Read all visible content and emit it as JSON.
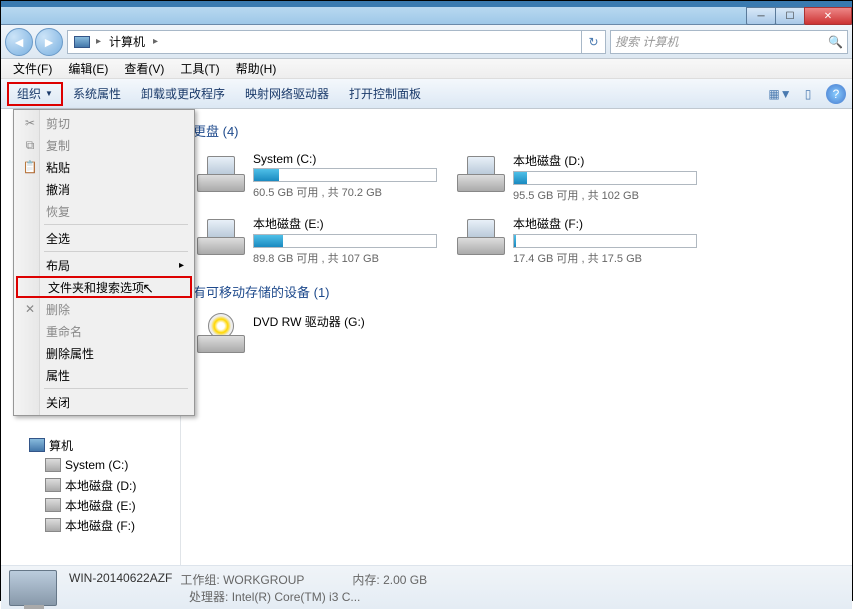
{
  "window": {
    "minimize": "─",
    "maximize": "☐",
    "close": "✕"
  },
  "nav": {
    "back": "◄",
    "fwd": "►",
    "path_root": "计算机",
    "path_arrow": "▸",
    "refresh": "↻",
    "search_placeholder": "搜索 计算机",
    "search_icon": "🔍"
  },
  "menu": {
    "file": "文件(F)",
    "edit": "编辑(E)",
    "view": "查看(V)",
    "tools": "工具(T)",
    "help": "帮助(H)"
  },
  "toolbar": {
    "organize": "组织",
    "drop": "▼",
    "sysprops": "系统属性",
    "uninstall": "卸载或更改程序",
    "mapdrive": "映射网络驱动器",
    "controlpanel": "打开控制面板",
    "viewicon": "▦",
    "paneicon": "▯",
    "helpicon": "?"
  },
  "dropdown": {
    "cut": "剪切",
    "copy": "复制",
    "paste": "粘贴",
    "undo": "撤消",
    "redo": "恢复",
    "selectall": "全选",
    "layout": "布局",
    "folderoptions": "文件夹和搜索选项",
    "delete": "删除",
    "rename": "重命名",
    "removeprops": "删除属性",
    "properties": "属性",
    "close": "关闭",
    "arrow": "▸",
    "cut_icon": "✂",
    "copy_icon": "⧉",
    "paste_icon": "📋",
    "del_icon": "✕"
  },
  "sidebar": {
    "computer_partial": "算机",
    "c": "System (C:)",
    "d": "本地磁盘 (D:)",
    "e": "本地磁盘 (E:)",
    "f": "本地磁盘 (F:)"
  },
  "groups": {
    "hdd_partial": "更盘 (4)",
    "removable": "有可移动存储的设备 (1)"
  },
  "drives": [
    {
      "name": "System (C:)",
      "stat": "60.5 GB 可用 , 共 70.2 GB",
      "pct": 14
    },
    {
      "name": "本地磁盘 (D:)",
      "stat": "95.5 GB 可用 , 共 102 GB",
      "pct": 7
    },
    {
      "name": "本地磁盘 (E:)",
      "stat": "89.8 GB 可用 , 共 107 GB",
      "pct": 16
    },
    {
      "name": "本地磁盘 (F:)",
      "stat": "17.4 GB 可用 , 共 17.5 GB",
      "pct": 1
    }
  ],
  "dvd": {
    "name": "DVD RW 驱动器 (G:)"
  },
  "status": {
    "name": "WIN-20140622AZF",
    "workgroup_lbl": "工作组:",
    "workgroup": "WORKGROUP",
    "mem_lbl": "内存:",
    "mem": "2.00 GB",
    "cpu_lbl": "处理器:",
    "cpu": "Intel(R) Core(TM) i3 C..."
  }
}
